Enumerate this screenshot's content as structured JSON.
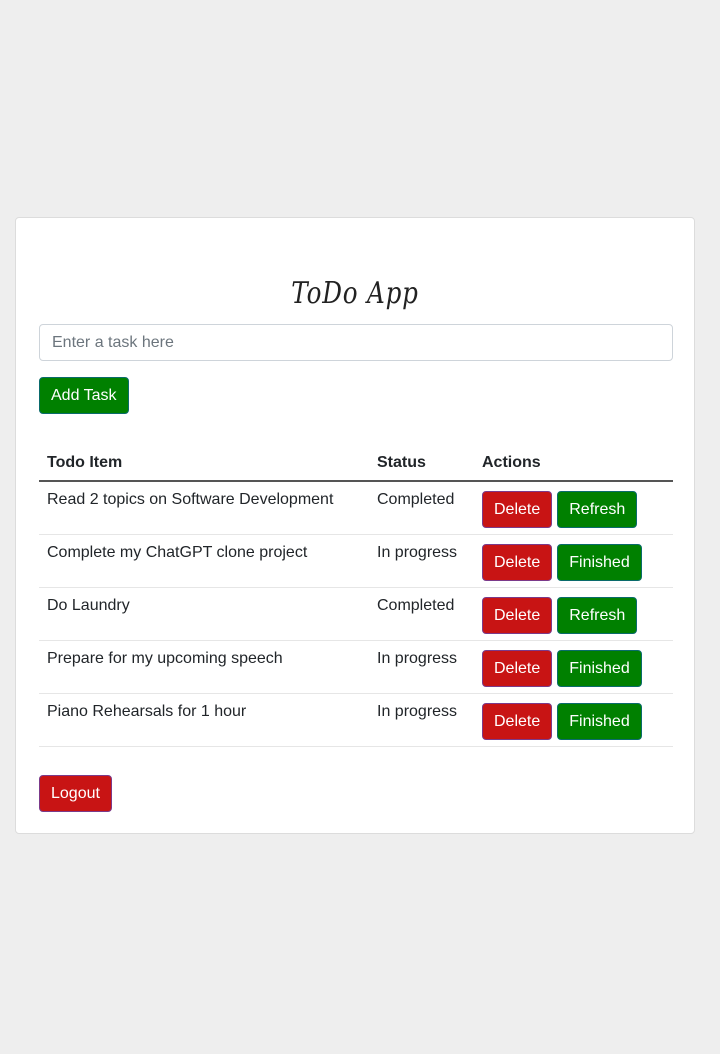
{
  "app": {
    "title": "ToDo App"
  },
  "input": {
    "placeholder": "Enter a task here",
    "value": ""
  },
  "buttons": {
    "add_task": "Add Task",
    "logout": "Logout"
  },
  "table": {
    "headers": [
      "Todo Item",
      "Status",
      "Actions"
    ],
    "rows": [
      {
        "item": "Read 2 topics on Software Development",
        "status": "Completed",
        "delete": "Delete",
        "action": "Refresh"
      },
      {
        "item": "Complete my ChatGPT clone project",
        "status": "In progress",
        "delete": "Delete",
        "action": "Finished"
      },
      {
        "item": "Do Laundry",
        "status": "Completed",
        "delete": "Delete",
        "action": "Refresh"
      },
      {
        "item": "Prepare for my upcoming speech",
        "status": "In progress",
        "delete": "Delete",
        "action": "Finished"
      },
      {
        "item": "Piano Rehearsals for 1 hour",
        "status": "In progress",
        "delete": "Delete",
        "action": "Finished"
      }
    ]
  },
  "colors": {
    "background": "#eeeeee",
    "card": "#ffffff",
    "primary_green": "#008000",
    "danger_red": "#c81414"
  }
}
